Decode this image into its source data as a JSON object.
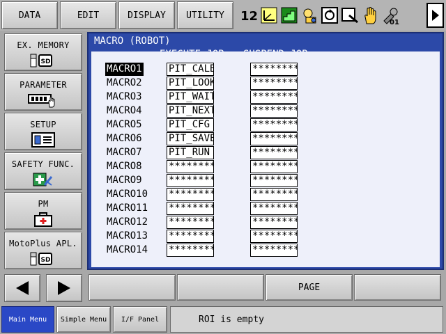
{
  "topbar": {
    "menus": [
      "DATA",
      "EDIT",
      "DISPLAY",
      "UTILITY"
    ],
    "status_icons": [
      "robot-group-icon",
      "coordinate-icon",
      "speed-icon",
      "security-icon",
      "cycle-icon",
      "servo-icon",
      "hand-icon",
      "tool-icon"
    ],
    "status_text": {
      "group": "12",
      "tool": "01"
    }
  },
  "sidebar": {
    "items": [
      {
        "label": "EX. MEMORY",
        "icon": "sd-card-icon",
        "icon_text": "SD"
      },
      {
        "label": "PARAMETER",
        "icon": "parameter-icon",
        "icon_text": ""
      },
      {
        "label": "SETUP",
        "icon": "setup-icon",
        "icon_text": ""
      },
      {
        "label": "SAFETY FUNC.",
        "icon": "safety-icon",
        "icon_text": ""
      },
      {
        "label": "PM",
        "icon": "pm-icon",
        "icon_text": ""
      },
      {
        "label": "MotoPlus APL.",
        "icon": "sd-card-icon",
        "icon_text": "SD"
      }
    ]
  },
  "main": {
    "title": "MACRO (ROBOT)",
    "columns": {
      "execute": "EXECUTE JOB",
      "suspend": "SUSPEND JOB"
    },
    "selected_row": 0,
    "rows": [
      {
        "name": "MACRO1",
        "execute": "PIT_CALB",
        "suspend": "********"
      },
      {
        "name": "MACRO2",
        "execute": "PIT_LOOK",
        "suspend": "********"
      },
      {
        "name": "MACRO3",
        "execute": "PIT_WAIT",
        "suspend": "********"
      },
      {
        "name": "MACRO4",
        "execute": "PIT_NEXT",
        "suspend": "********"
      },
      {
        "name": "MACRO5",
        "execute": "PIT_CFG",
        "suspend": "********"
      },
      {
        "name": "MACRO6",
        "execute": "PIT_SAVE",
        "suspend": "********"
      },
      {
        "name": "MACRO7",
        "execute": "PIT_RUN",
        "suspend": "********"
      },
      {
        "name": "MACRO8",
        "execute": "********",
        "suspend": "********"
      },
      {
        "name": "MACRO9",
        "execute": "********",
        "suspend": "********"
      },
      {
        "name": "MACRO10",
        "execute": "********",
        "suspend": "********"
      },
      {
        "name": "MACRO11",
        "execute": "********",
        "suspend": "********"
      },
      {
        "name": "MACRO12",
        "execute": "********",
        "suspend": "********"
      },
      {
        "name": "MACRO13",
        "execute": "********",
        "suspend": "********"
      },
      {
        "name": "MACRO14",
        "execute": "********",
        "suspend": "********"
      }
    ]
  },
  "fkeys": [
    "",
    "",
    "PAGE",
    ""
  ],
  "bottom": {
    "main_menu": "Main Menu",
    "simple_menu": "Simple Menu",
    "if_panel": "I/F Panel",
    "status": "ROI is empty"
  },
  "colors": {
    "panel_blue": "#2c49a8",
    "active_tab": "#2a48c6",
    "chrome_gray": "#a8a8a8"
  }
}
